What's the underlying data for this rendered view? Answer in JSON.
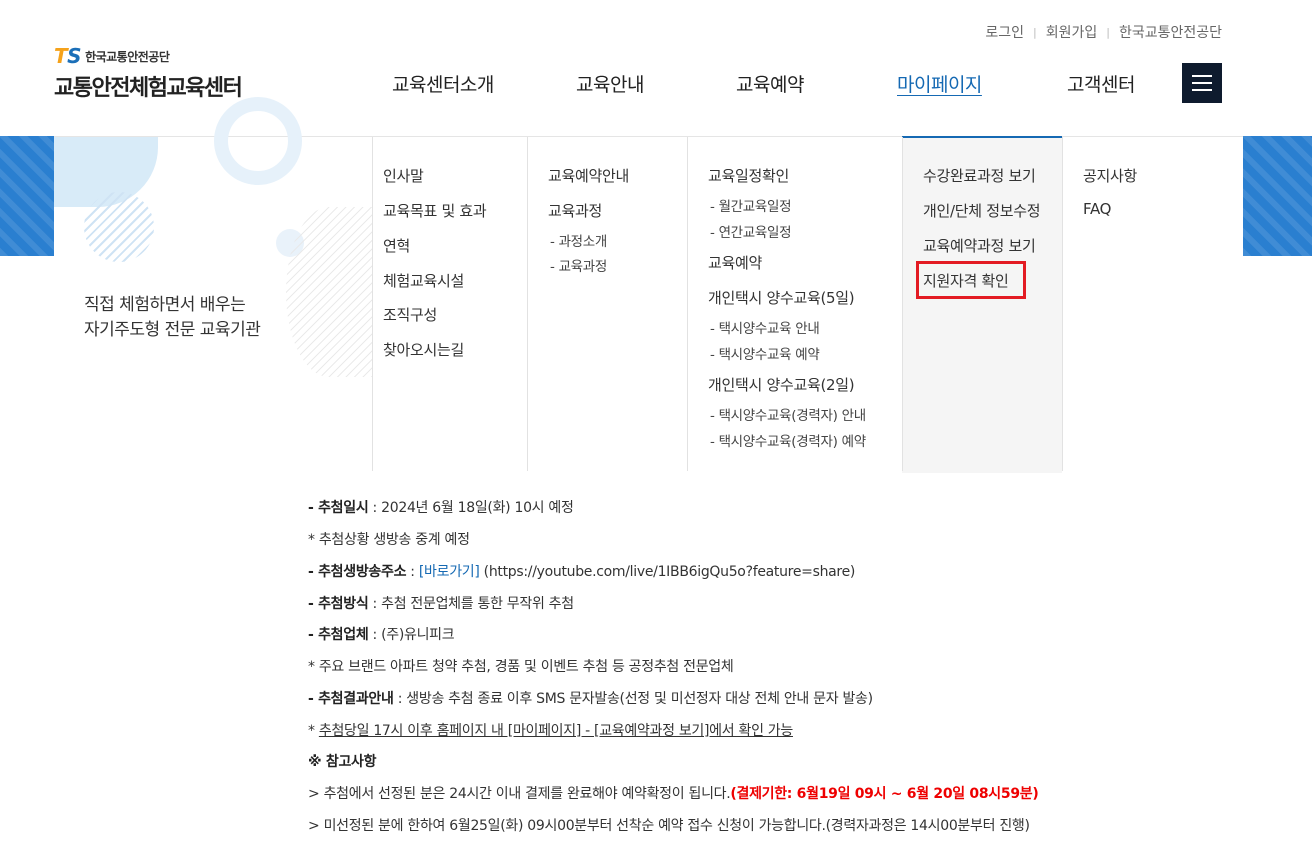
{
  "util": [
    "로그인",
    "회원가입",
    "한국교통안전공단"
  ],
  "logo": {
    "ts": "TS",
    "org": "한국교통안전공단",
    "title": "교통안전체험교육센터"
  },
  "gnb": [
    "교육센터소개",
    "교육안내",
    "교육예약",
    "마이페이지",
    "고객센터"
  ],
  "gnb_active": "마이페이지",
  "slogan": [
    "직접 체험하면서 배우는",
    "자기주도형 전문 교육기관"
  ],
  "menu": {
    "col1": [
      "인사말",
      "교육목표 및 효과",
      "연혁",
      "체험교육시설",
      "조직구성",
      "찾아오시는길"
    ],
    "col2": {
      "a": "교육예약안내",
      "b": "교육과정",
      "b_sub": [
        "- 과정소개",
        "- 교육과정"
      ]
    },
    "col3": {
      "a": "교육일정확인",
      "a_sub": [
        "- 월간교육일정",
        "- 연간교육일정"
      ],
      "b": "교육예약",
      "c": "개인택시 양수교육(5일)",
      "c_sub": [
        "- 택시양수교육 안내",
        "- 택시양수교육 예약"
      ],
      "d": "개인택시 양수교육(2일)",
      "d_sub": [
        "- 택시양수교육(경력자) 안내",
        "- 택시양수교육(경력자) 예약"
      ]
    },
    "col4": [
      "수강완료과정 보기",
      "개인/단체 정보수정",
      "교육예약과정 보기",
      "지원자격 확인"
    ],
    "col5": [
      "공지사항",
      "FAQ"
    ]
  },
  "content": {
    "l1_label": "- 추첨일시",
    "l1_text": " : 2024년 6월 18일(화) 10시 예정",
    "l2": " * 추첨상황 생방송 중계 예정",
    "l3_label": "- 추첨생방송주소",
    "l3_sep": " : ",
    "l3_link": "[바로가기]",
    "l3_url": " (https://youtube.com/live/1IBB6igQu5o?feature=share)",
    "l4_label": "- 추첨방식",
    "l4_text": " : 추첨 전문업체를 통한 무작위 추첨",
    "l5_label": "- 추첨업체",
    "l5_text": " : (주)유니피크",
    "l6": " * 주요 브랜드 아파트 청약 추첨, 경품 및 이벤트 추첨 등 공정추첨 전문업체",
    "l7_label": "- 추첨결과안내",
    "l7_text": " : 생방송 추첨 종료 이후 SMS 문자발송(선정 및 미선정자 대상 전체 안내 문자 발송)",
    "l8_star": " * ",
    "l8_text": "추첨당일 17시 이후 홈페이지 내 [마이페이지] - [교육예약과정 보기]에서 확인 가능",
    "l9": "※ 참고사항",
    "l10_text": " > 추첨에서 선정된 분은 24시간 이내 결제를 완료해야 예약확정이 됩니다.",
    "l10_red": "(결제기한: 6월19일 09시 ~ 6월 20일 08시59분)",
    "l11": " > 미선정된 분에 한하여 6월25일(화) 09시00분부터 선착순 예약 접수 신청이 가능합니다.(경력자과정은 14시00분부터 진행)"
  }
}
